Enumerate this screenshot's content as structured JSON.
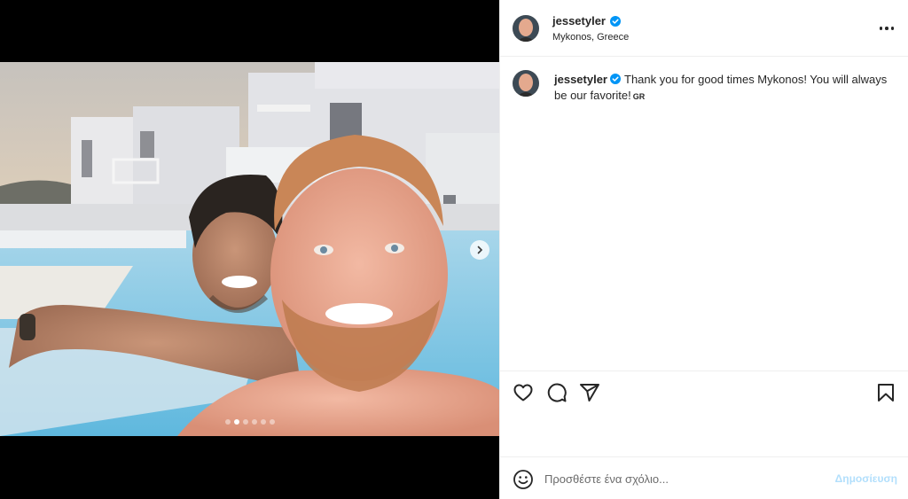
{
  "post": {
    "author": {
      "username": "jessetyler",
      "verified": true,
      "location": "Mykonos, Greece"
    },
    "caption": {
      "username": "jessetyler",
      "text": "Thank you for good times Mykonos! You will always be our favorite!",
      "language_badge": "GR"
    },
    "carousel": {
      "slide_count": 6,
      "active_index": 1
    }
  },
  "icons": {
    "more": "more-horizontal-icon",
    "like": "heart-icon",
    "comment": "comment-icon",
    "share": "paper-plane-icon",
    "save": "bookmark-icon",
    "emoji": "smiley-icon",
    "next": "chevron-right-icon",
    "verified": "verified-badge-icon"
  },
  "composer": {
    "placeholder": "Προσθέστε ένα σχόλιο...",
    "post_label": "Δημοσίευση"
  },
  "colors": {
    "verified": "#0095f6",
    "post_button_disabled": "#b2dffc",
    "text": "#262626",
    "border": "#efefef"
  }
}
